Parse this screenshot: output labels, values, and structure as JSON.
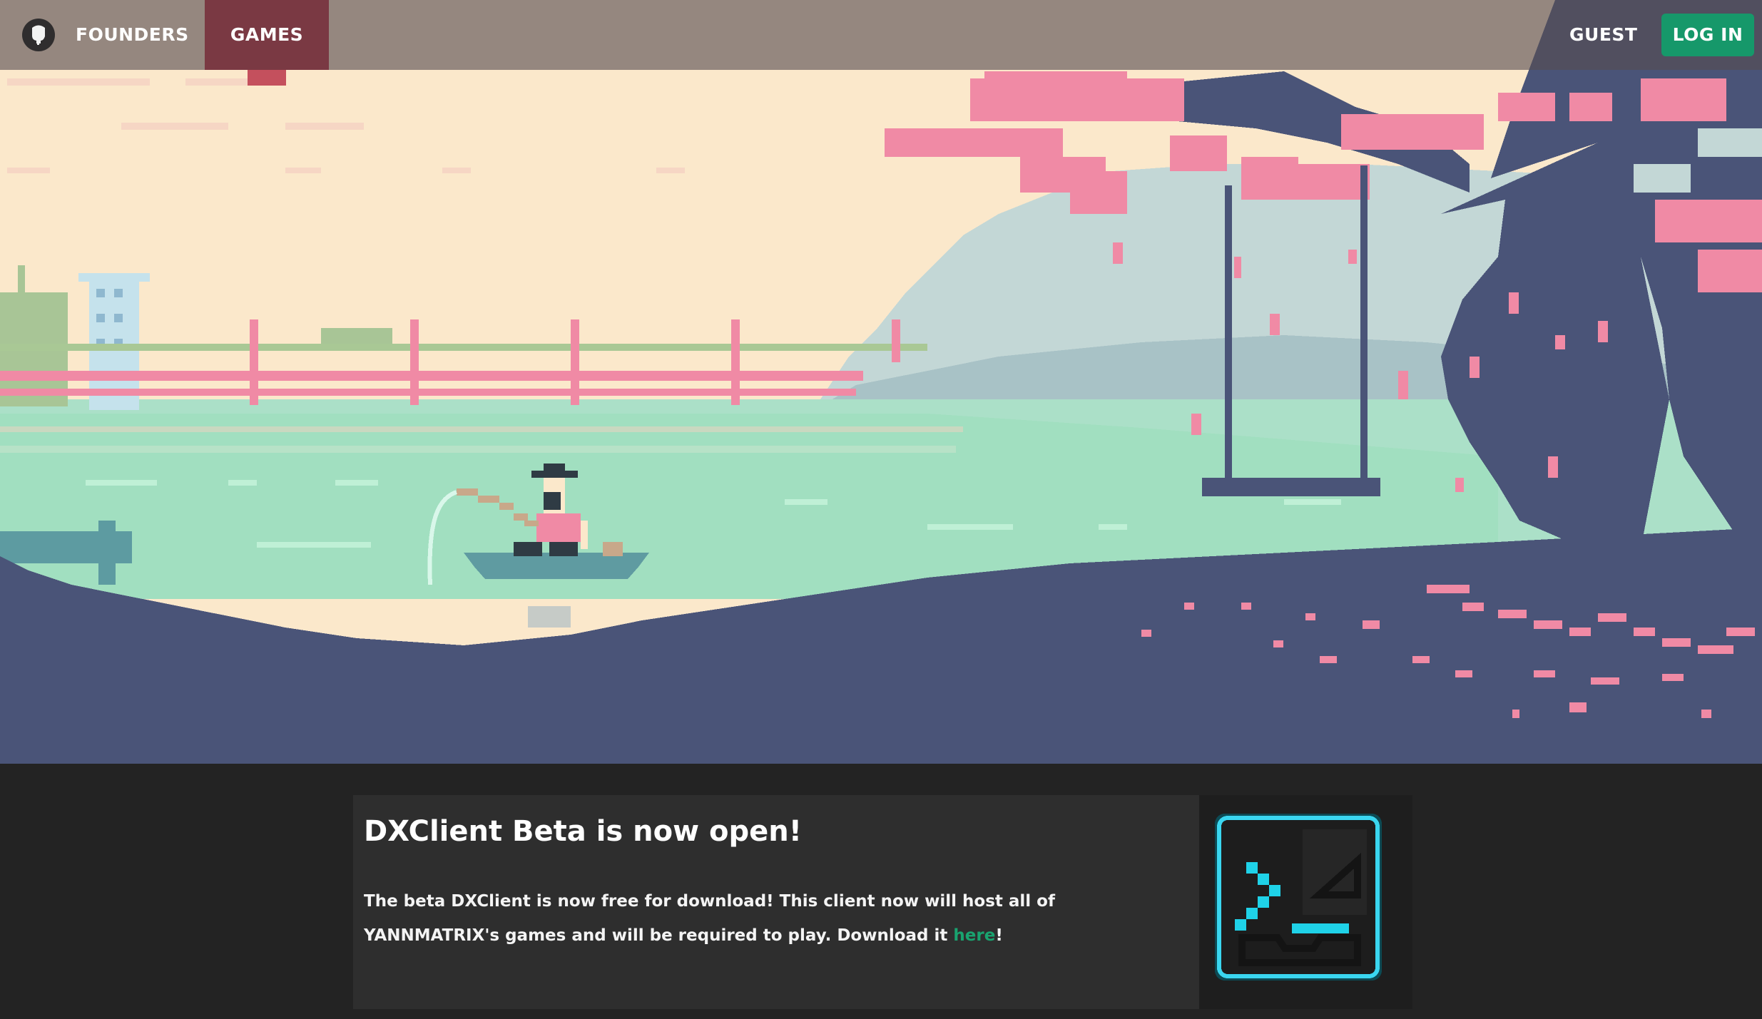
{
  "nav": {
    "logo_icon": "ghost-logo-icon",
    "founders_label": "FOUNDERS",
    "games_label": "GAMES",
    "guest_label": "GUEST",
    "login_label": "LOG IN"
  },
  "news": {
    "title": "DXClient Beta is now open!",
    "body_before_link": "The beta DXClient is now free for download! This client now will host all of YANNMATRIX's games and will be required to play. Download it ",
    "link_text": "here",
    "body_after_link": "!",
    "image_icon": "terminal-app-icon"
  },
  "colors": {
    "accent": "#16986a",
    "games_active": "#7a3943",
    "link": "#19a36f",
    "page_bg": "#232323",
    "card_bg": "#2e2e2e"
  }
}
